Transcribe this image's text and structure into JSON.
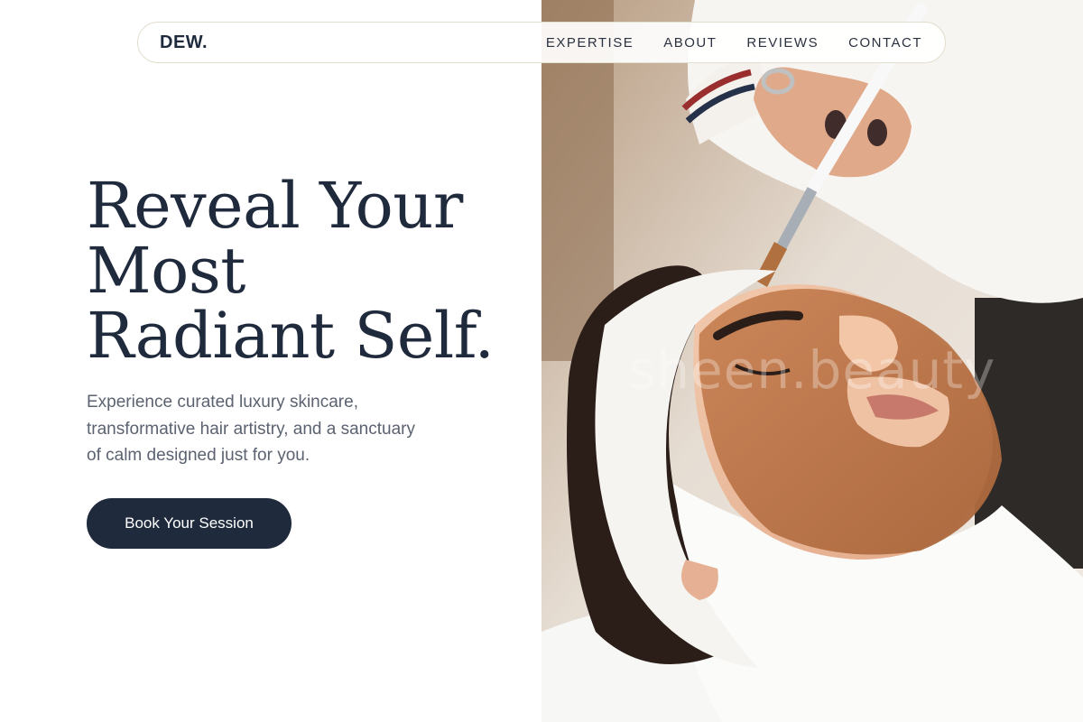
{
  "brand": {
    "logo": "DEW."
  },
  "nav": {
    "links": [
      {
        "label": "EXPERTISE"
      },
      {
        "label": "ABOUT"
      },
      {
        "label": "REVIEWS"
      },
      {
        "label": "CONTACT"
      }
    ]
  },
  "hero": {
    "headline_lines": [
      "Reveal Your",
      "Most",
      "Radiant Self."
    ],
    "subtext_lines": [
      "Experience curated luxury skincare,",
      "transformative hair artistry, and a sanctuary",
      "of calm designed just for you."
    ],
    "cta_label": "Book Your Session",
    "image_watermark": "sheen.beauty"
  },
  "colors": {
    "navy": "#1f2a3d",
    "body_text": "#5b6270",
    "nav_border": "#e3dfcf",
    "mask_clay": "#b97444"
  }
}
